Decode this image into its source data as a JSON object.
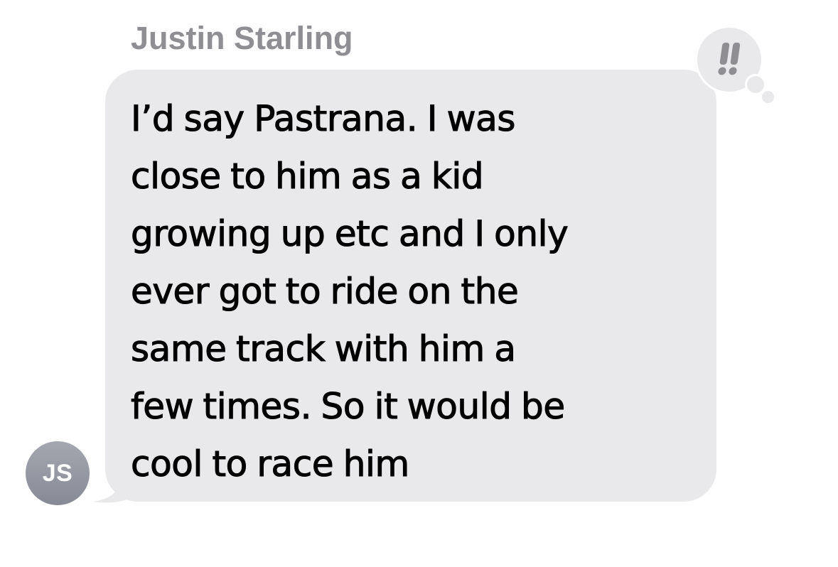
{
  "conversation": {
    "sender_name": "Justin Starling",
    "avatar_initials": "JS",
    "message": {
      "lines": [
        "I’d say Pastrana. I was",
        "close to him as a kid",
        "growing up etc and I only",
        "ever got to ride on the",
        "same track with him a",
        "few times. So it would be",
        "cool to race him"
      ],
      "bubble_color": "#e9e9eb",
      "text_color": "#000000"
    },
    "tapback": {
      "icon": "double-exclamation-icon",
      "color": "#8e8e93"
    },
    "avatar_color": "#9a9ca5",
    "sender_name_color": "#8e8e93"
  }
}
